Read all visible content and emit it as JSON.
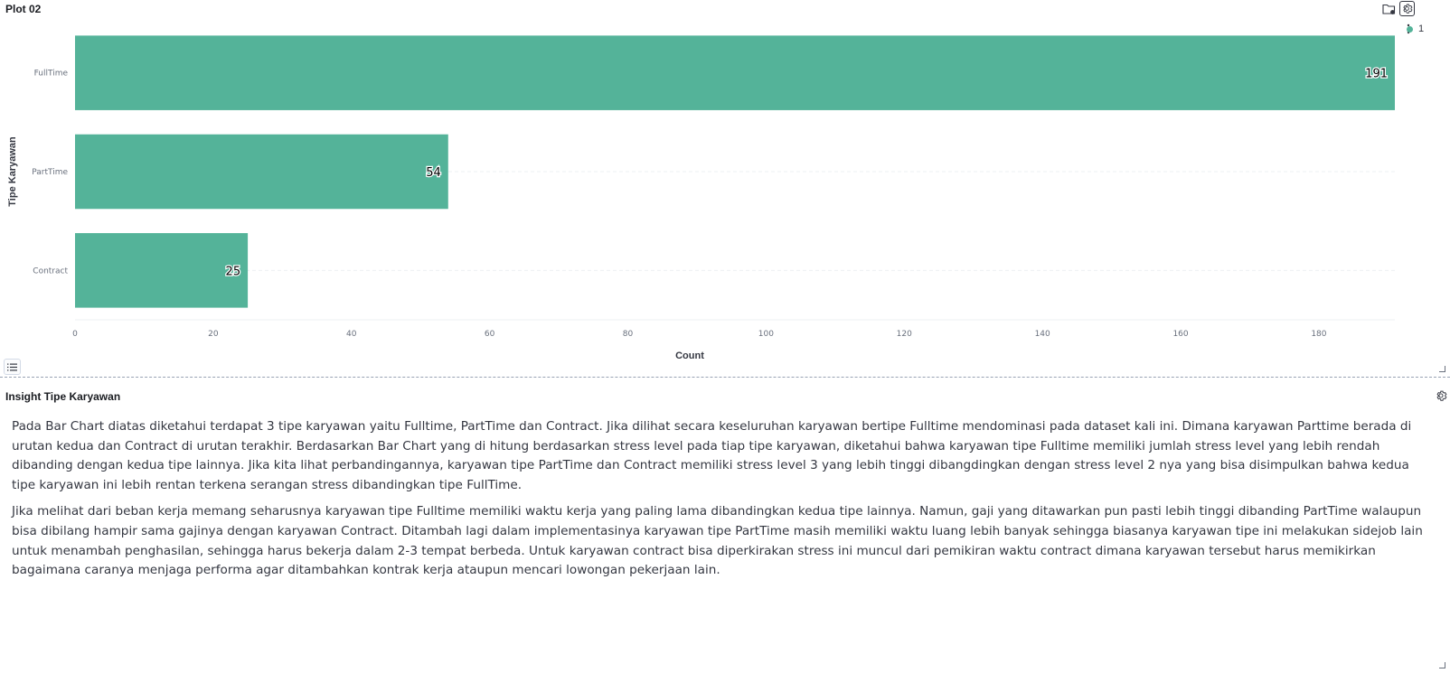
{
  "plot_panel": {
    "title": "Plot 02",
    "legend_label": "1"
  },
  "chart_data": {
    "type": "bar",
    "orientation": "horizontal",
    "categories": [
      "FullTime",
      "PartTime",
      "Contract"
    ],
    "values": [
      191,
      54,
      25
    ],
    "data_labels": [
      "191",
      "54",
      "25"
    ],
    "xlabel": "Count",
    "ylabel": "Tipe Karyawan",
    "xlim": [
      0,
      191
    ],
    "xticks": [
      "0",
      "20",
      "40",
      "60",
      "80",
      "100",
      "120",
      "140",
      "160",
      "180"
    ],
    "bar_color": "#54b399",
    "grid": "horizontal dashed",
    "legend": "top-right"
  },
  "insight_panel": {
    "title": "Insight Tipe Karyawan",
    "paragraphs": [
      "Pada Bar Chart diatas diketahui terdapat 3 tipe karyawan yaitu Fulltime, PartTime dan Contract. Jika dilihat secara keseluruhan karyawan bertipe Fulltime mendominasi pada dataset kali ini. Dimana karyawan Parttime berada di urutan kedua dan Contract di urutan terakhir. Berdasarkan Bar Chart yang di hitung berdasarkan stress level pada tiap tipe karyawan, diketahui bahwa karyawan tipe Fulltime memiliki jumlah stress level yang lebih rendah dibanding dengan kedua tipe lainnya. Jika kita lihat perbandingannya, karyawan tipe PartTime dan Contract memiliki stress level 3 yang lebih tinggi dibangdingkan dengan stress level 2 nya yang bisa disimpulkan bahwa kedua tipe karyawan ini lebih rentan terkena serangan stress dibandingkan tipe FullTime.",
      "Jika melihat dari beban kerja memang seharusnya karyawan tipe Fulltime memiliki waktu kerja yang paling lama dibandingkan kedua tipe lainnya. Namun, gaji yang ditawarkan pun pasti lebih tinggi dibanding PartTime walaupun bisa dibilang hampir sama gajinya dengan karyawan Contract. Ditambah lagi dalam implementasinya karyawan tipe PartTime masih memiliki waktu luang lebih banyak sehingga biasanya karyawan tipe ini melakukan sidejob lain untuk menambah penghasilan, sehingga harus bekerja dalam 2-3 tempat berbeda. Untuk karyawan contract bisa diperkirakan stress ini muncul dari pemikiran waktu contract dimana karyawan tersebut harus memikirkan bagaimana caranya menjaga performa agar ditambahkan kontrak kerja ataupun mencari lowongan pekerjaan lain."
    ]
  },
  "icons": {
    "inspect": "folder-inspect-icon",
    "settings": "gear-icon",
    "more": "more-vertical-icon",
    "legend_toggle": "list-icon",
    "resize": "resize-handle-icon"
  }
}
